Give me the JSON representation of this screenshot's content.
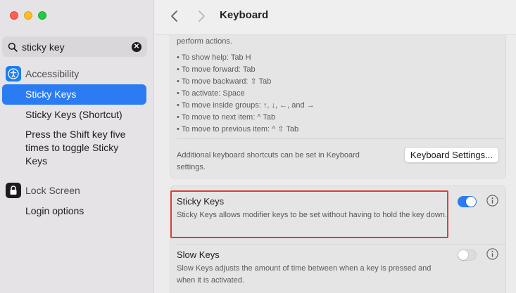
{
  "sidebar": {
    "search": {
      "value": "sticky key",
      "icon": "magnifying-glass-icon",
      "clear_icon": "clear-x-icon"
    },
    "groups": [
      {
        "label": "Accessibility",
        "icon": "accessibility-icon",
        "items": [
          {
            "label": "Sticky Keys",
            "selected": true
          },
          {
            "label": "Sticky Keys (Shortcut)",
            "selected": false
          },
          {
            "label": "Press the Shift key five times to toggle Sticky Keys",
            "selected": false
          }
        ]
      },
      {
        "label": "Lock Screen",
        "icon": "lock-icon",
        "items": [
          {
            "label": "Login options",
            "selected": false
          }
        ]
      }
    ]
  },
  "header": {
    "title": "Keyboard"
  },
  "main": {
    "intro_tail": "perform actions.",
    "shortcuts": [
      "• To show help: Tab H",
      "• To move forward: Tab",
      "• To move backward: ⇧ Tab",
      "• To activate: Space",
      "• To move inside groups: ↑, ↓, ←, and →",
      "• To move to next item: ^ Tab",
      "• To move to previous item: ^ ⇧ Tab"
    ],
    "additional_note": "Additional keyboard shortcuts can be set in Keyboard settings.",
    "keyboard_settings_button": "Keyboard Settings...",
    "settings": [
      {
        "title": "Sticky Keys",
        "description": "Sticky Keys allows modifier keys to be set without having to hold the key down.",
        "enabled": true
      },
      {
        "title": "Slow Keys",
        "description": "Slow Keys adjusts the amount of time between when a key is pressed and when it is activated.",
        "enabled": false
      }
    ]
  },
  "colors": {
    "accent": "#2b7cf3",
    "highlight_border": "#dc3f3a"
  }
}
